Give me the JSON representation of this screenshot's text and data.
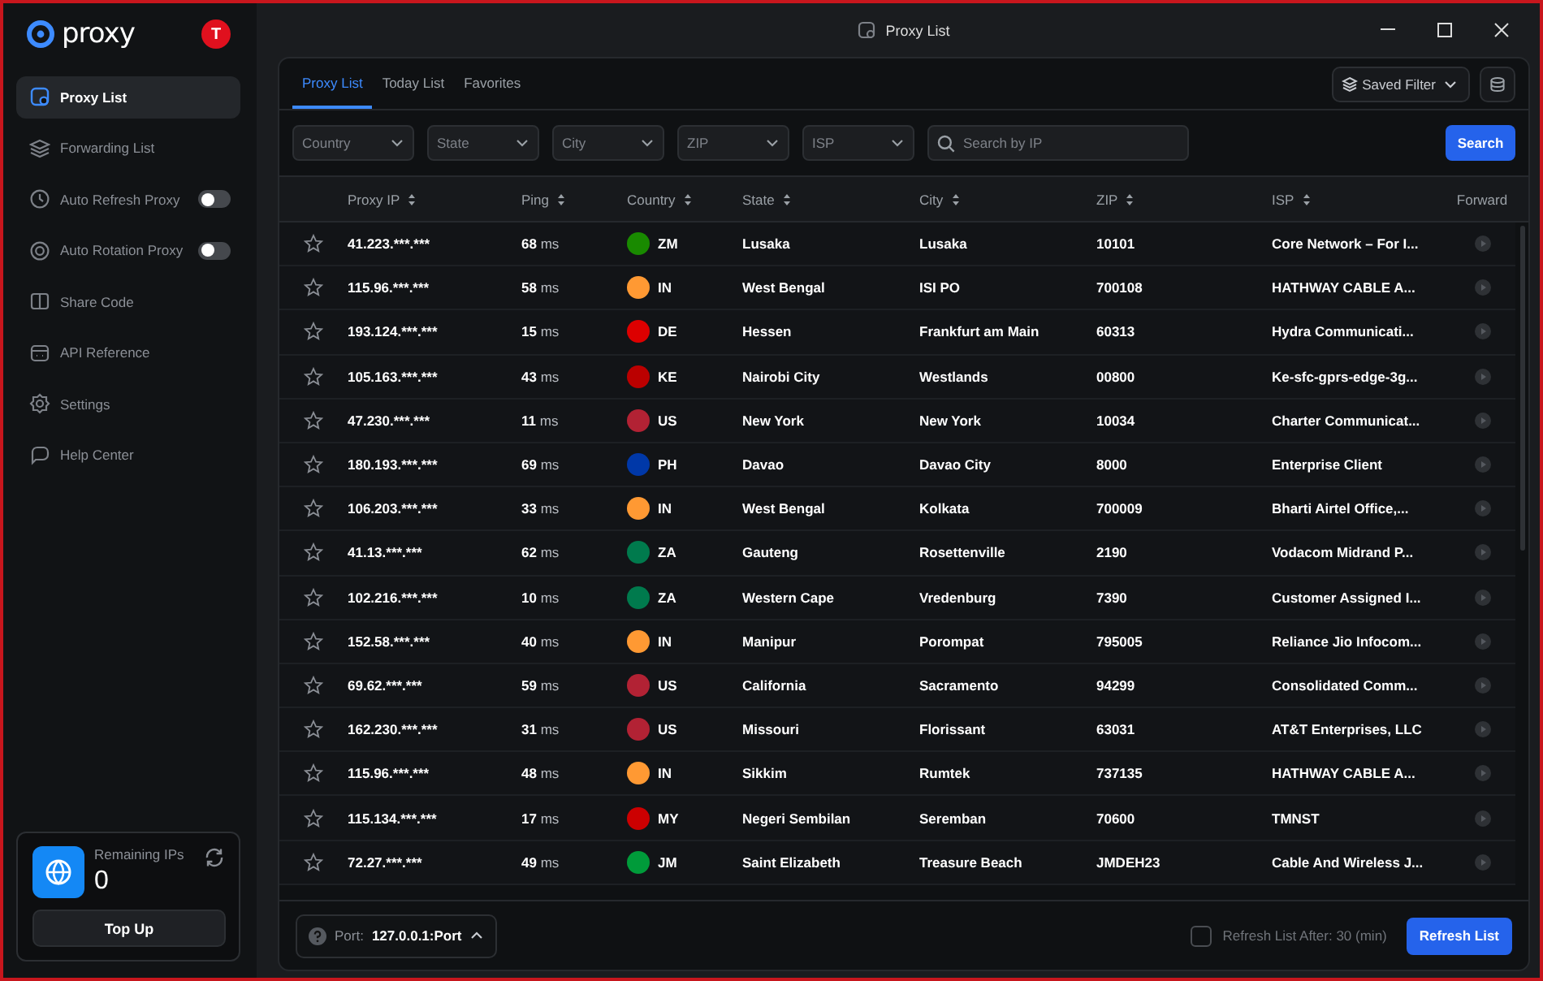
{
  "window": {
    "title": "Proxy List"
  },
  "sidebar": {
    "logo": "proxy",
    "avatar": "T",
    "items": [
      {
        "label": "Proxy List",
        "selected": true,
        "kind": "link"
      },
      {
        "label": "Forwarding List",
        "selected": false,
        "kind": "link"
      },
      {
        "label": "Auto Refresh Proxy",
        "selected": false,
        "kind": "toggle",
        "on": false
      },
      {
        "label": "Auto Rotation Proxy",
        "selected": false,
        "kind": "toggle",
        "on": false
      },
      {
        "label": "Share Code",
        "selected": false,
        "kind": "link"
      },
      {
        "label": "API Reference",
        "selected": false,
        "kind": "link"
      },
      {
        "label": "Settings",
        "selected": false,
        "kind": "link"
      },
      {
        "label": "Help Center",
        "selected": false,
        "kind": "link"
      }
    ],
    "remaining": {
      "label": "Remaining IPs",
      "value": "0",
      "button": "Top Up"
    }
  },
  "tabs": [
    {
      "label": "Proxy List",
      "selected": true
    },
    {
      "label": "Today List",
      "selected": false
    },
    {
      "label": "Favorites",
      "selected": false
    }
  ],
  "saved_filter": "Saved Filter",
  "filters": [
    {
      "placeholder": "Country"
    },
    {
      "placeholder": "State"
    },
    {
      "placeholder": "City"
    },
    {
      "placeholder": "ZIP"
    },
    {
      "placeholder": "ISP"
    }
  ],
  "search": {
    "placeholder": "Search by IP",
    "button": "Search"
  },
  "table": {
    "columns": [
      {
        "label": "Proxy IP",
        "sortable": true
      },
      {
        "label": "Ping",
        "sortable": true
      },
      {
        "label": "Country",
        "sortable": true
      },
      {
        "label": "State",
        "sortable": true
      },
      {
        "label": "City",
        "sortable": true
      },
      {
        "label": "ZIP",
        "sortable": true
      },
      {
        "label": "ISP",
        "sortable": true
      },
      {
        "label": "Forward",
        "sortable": false
      }
    ],
    "rows": [
      {
        "favorite": false,
        "ip": "41.223.***.***",
        "ping": "**68** ms",
        "color": "#198a00",
        "country": "ZM",
        "state": "Lusaka",
        "city": "Lusaka",
        "zip": "10101",
        "isp": "Core Network – For I..."
      },
      {
        "favorite": false,
        "ip": "115.96.***.***",
        "ping": "**58** ms",
        "color": "#ff9933",
        "country": "IN",
        "state": "West Bengal",
        "city": "ISI PO",
        "zip": "700108",
        "isp": "HATHWAY CABLE A..."
      },
      {
        "favorite": false,
        "ip": "193.124.***.***",
        "ping": "**15** ms",
        "color": "#dd0000",
        "country": "DE",
        "state": "Hessen",
        "city": "Frankfurt am Main",
        "zip": "60313",
        "isp": "Hydra Communicati..."
      },
      {
        "favorite": false,
        "ip": "105.163.***.***",
        "ping": "**43** ms",
        "color": "#bb0000",
        "country": "KE",
        "state": "Nairobi City",
        "city": "Westlands",
        "zip": "00800",
        "isp": "Ke-sfc-gprs-edge-3g..."
      },
      {
        "favorite": false,
        "ip": "47.230.***.***",
        "ping": "**11** ms",
        "color": "#b22234",
        "country": "US",
        "state": "New York",
        "city": "New York",
        "zip": "10034",
        "isp": "Charter Communicat..."
      },
      {
        "favorite": false,
        "ip": "180.193.***.***",
        "ping": "**69** ms",
        "color": "#0038a8",
        "country": "PH",
        "state": "Davao",
        "city": "Davao City",
        "zip": "8000",
        "isp": "Enterprise Client"
      },
      {
        "favorite": false,
        "ip": "106.203.***.***",
        "ping": "**33** ms",
        "color": "#ff9933",
        "country": "IN",
        "state": "West Bengal",
        "city": "Kolkata",
        "zip": "700009",
        "isp": "Bharti Airtel Office,..."
      },
      {
        "favorite": false,
        "ip": "41.13.***.***",
        "ping": "**62** ms",
        "color": "#007a4d",
        "country": "ZA",
        "state": "Gauteng",
        "city": "Rosettenville",
        "zip": "2190",
        "isp": "Vodacom Midrand P..."
      },
      {
        "favorite": false,
        "ip": "102.216.***.***",
        "ping": "**10** ms",
        "color": "#007a4d",
        "country": "ZA",
        "state": "Western Cape",
        "city": "Vredenburg",
        "zip": "7390",
        "isp": "Customer Assigned I..."
      },
      {
        "favorite": false,
        "ip": "152.58.***.***",
        "ping": "**40** ms",
        "color": "#ff9933",
        "country": "IN",
        "state": "Manipur",
        "city": "Porompat",
        "zip": "795005",
        "isp": "Reliance Jio Infocom..."
      },
      {
        "favorite": false,
        "ip": "69.62.***.***",
        "ping": "**59** ms",
        "color": "#b22234",
        "country": "US",
        "state": "California",
        "city": "Sacramento",
        "zip": "94299",
        "isp": "Consolidated Comm..."
      },
      {
        "favorite": false,
        "ip": "162.230.***.***",
        "ping": "**31** ms",
        "color": "#b22234",
        "country": "US",
        "state": "Missouri",
        "city": "Florissant",
        "zip": "63031",
        "isp": "AT&T Enterprises, LLC"
      },
      {
        "favorite": false,
        "ip": "115.96.***.***",
        "ping": "**48** ms",
        "color": "#ff9933",
        "country": "IN",
        "state": "Sikkim",
        "city": "Rumtek",
        "zip": "737135",
        "isp": "HATHWAY CABLE A..."
      },
      {
        "favorite": false,
        "ip": "115.134.***.***",
        "ping": "**17** ms",
        "color": "#cc0001",
        "country": "MY",
        "state": "Negeri Sembilan",
        "city": "Seremban",
        "zip": "70600",
        "isp": "TMNST"
      },
      {
        "favorite": false,
        "ip": "72.27.***.***",
        "ping": "**49** ms",
        "color": "#009b3a",
        "country": "JM",
        "state": "Saint Elizabeth",
        "city": "Treasure Beach",
        "zip": "JMDEH23",
        "isp": "Cable And Wireless J..."
      }
    ]
  },
  "footer": {
    "port_label": "Port:",
    "port": "127.0.0.1:Port",
    "auto_refresh": {
      "label": "Refresh List After: 30 (min)",
      "checked": false
    },
    "button": "Refresh List"
  }
}
